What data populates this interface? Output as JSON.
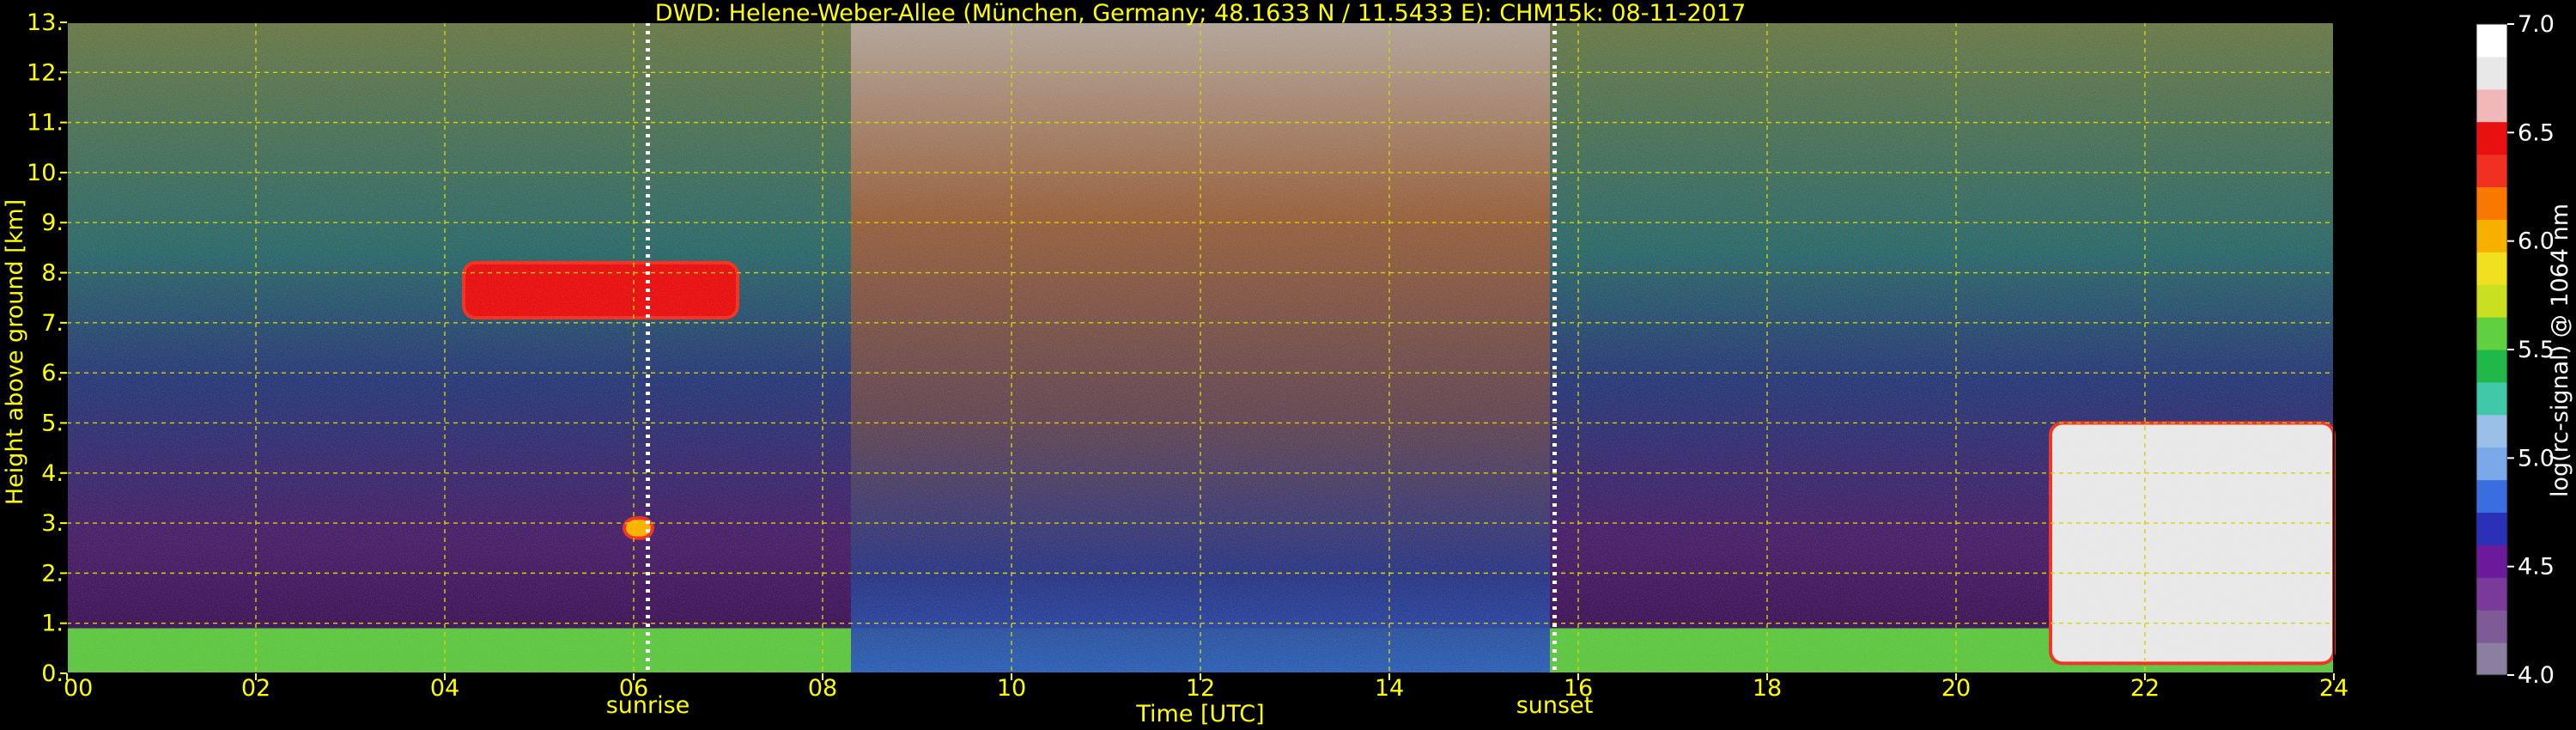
{
  "chart_data": {
    "type": "heatmap",
    "title": "DWD: Helene-Weber-Allee (München, Germany; 48.1633 N / 11.5433 E):    CHM15k: 08-11-2017",
    "xlabel": "Time [UTC]",
    "ylabel": "Height above ground [km]",
    "xlim": [
      0,
      24
    ],
    "ylim": [
      0,
      13
    ],
    "x_ticks": [
      0,
      2,
      4,
      6,
      8,
      10,
      12,
      14,
      16,
      18,
      20,
      22,
      24
    ],
    "x_tick_labels": [
      "00",
      "02",
      "04",
      "06",
      "08",
      "10",
      "12",
      "14",
      "16",
      "18",
      "20",
      "22",
      "24"
    ],
    "y_ticks": [
      0,
      1,
      2,
      3,
      4,
      5,
      6,
      7,
      8,
      9,
      10,
      11,
      12,
      13
    ],
    "y_tick_labels": [
      "0.",
      "1.",
      "2.",
      "3.",
      "4.",
      "5.",
      "6.",
      "7.",
      "8.",
      "9.",
      "10.",
      "11.",
      "12.",
      "13."
    ],
    "grid": true,
    "markers": [
      {
        "label": "sunrise",
        "x": 6.15
      },
      {
        "label": "sunset",
        "x": 15.75
      }
    ],
    "colorbar": {
      "label": "log(rc-signal) @ 1064 nm",
      "range": [
        4.0,
        7.0
      ],
      "ticks": [
        4.0,
        4.5,
        5.0,
        5.5,
        6.0,
        6.5,
        7.0
      ],
      "tick_labels": [
        "4.0",
        "4.5",
        "5.0",
        "5.5",
        "6.0",
        "6.5",
        "7.0"
      ],
      "colors": [
        "#8a7fa0",
        "#7e5a96",
        "#7a3a9a",
        "#6a1a9a",
        "#2a30b8",
        "#3a6ee0",
        "#7aa8e8",
        "#9ac0e8",
        "#40c8a8",
        "#20b848",
        "#60d040",
        "#c8e020",
        "#f0e020",
        "#f8b000",
        "#f87800",
        "#f03020",
        "#e81010",
        "#f0b8b8",
        "#e8e8e8",
        "#ffffff"
      ]
    },
    "regions": [
      {
        "name": "boundary-layer",
        "x": [
          0,
          24
        ],
        "y": [
          0,
          0.9
        ],
        "level": 5.6
      },
      {
        "name": "cirrus-cloud",
        "x": [
          4.2,
          7.1
        ],
        "y": [
          7.1,
          8.2
        ],
        "level": 6.5
      },
      {
        "name": "small-cloud",
        "x": [
          5.9,
          6.2
        ],
        "y": [
          2.7,
          3.1
        ],
        "level": 6.0
      },
      {
        "name": "daytime-background",
        "x": [
          8.3,
          15.7
        ],
        "y": [
          0,
          13
        ],
        "level": 5.9
      },
      {
        "name": "evening-cloud",
        "x": [
          21.0,
          24
        ],
        "y": [
          0.2,
          5.0
        ],
        "level": 6.8
      }
    ]
  },
  "colors": {
    "text": "#ffff00",
    "colorbar_text": "#ffffff",
    "grid": "#d4d400",
    "background": "#000000"
  }
}
